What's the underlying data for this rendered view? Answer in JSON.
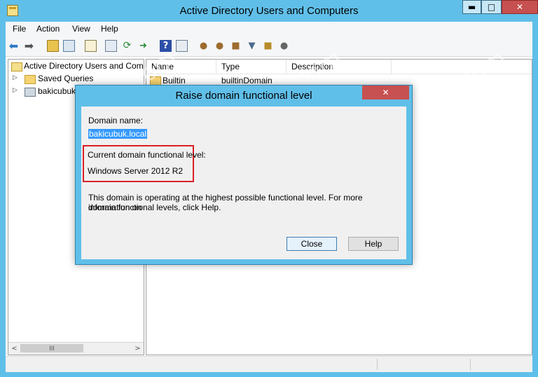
{
  "window": {
    "title": "Active Directory Users and Computers",
    "min_glyph": "▬",
    "max_glyph": "□",
    "close_glyph": "✕"
  },
  "menu": [
    "File",
    "Action",
    "View",
    "Help"
  ],
  "tree": {
    "items": [
      {
        "label": "Active Directory Users and Com",
        "arrow": ""
      },
      {
        "label": "Saved Queries",
        "arrow": "▷"
      },
      {
        "label": "bakicubuk",
        "arrow": "▷"
      }
    ],
    "scroll_thumb": "III",
    "scroll_left": "<",
    "scroll_right": ">"
  },
  "list": {
    "columns": [
      "Name",
      "Type",
      "Description"
    ],
    "rows": [
      {
        "name": "Builtin",
        "type": "builtinDomain",
        "description": ""
      }
    ]
  },
  "dialog": {
    "title": "Raise domain functional level",
    "close_glyph": "✕",
    "domain_name_label": "Domain name:",
    "domain_name_value": "bakicubuk.local",
    "current_level_label": "Current domain functional level:",
    "current_level_value": "Windows Server 2012 R2",
    "info_line1": "This domain is operating at the highest possible functional level. For more information on",
    "info_line2": "domain functional levels, click Help.",
    "close_button": "Close",
    "help_button": "Help"
  },
  "watermark": "bakicubuk.com",
  "colors": {
    "title_bar": "#60bfe9",
    "close_red": "#c75050",
    "selection_blue": "#3399ff",
    "highlight_red": "#d91f26"
  }
}
